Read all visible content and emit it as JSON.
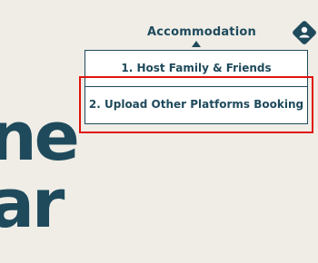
{
  "header": {
    "nav_label": "Accommodation"
  },
  "dropdown": {
    "items": [
      {
        "label": "1. Host Family & Friends"
      },
      {
        "label": "2. Upload Other Platforms Booking"
      }
    ]
  },
  "hero": {
    "line1": "ne",
    "line2": "ar"
  },
  "icons": {
    "user": "user-diamond-icon",
    "caret": "caret-up-icon"
  },
  "colors": {
    "background": "#efede6",
    "brand": "#1f4a5c",
    "highlight": "#e0140f"
  }
}
